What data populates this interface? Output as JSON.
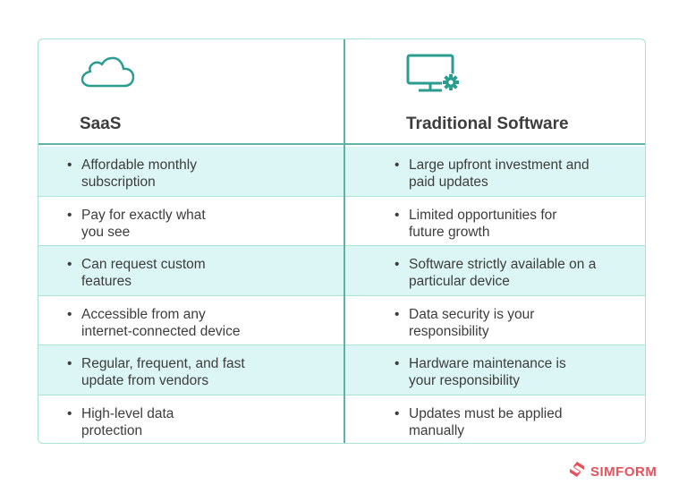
{
  "columns": [
    {
      "title": "SaaS",
      "icon": "cloud-icon"
    },
    {
      "title": "Traditional Software",
      "icon": "monitor-gear-icon"
    }
  ],
  "rows": [
    {
      "saas": "Affordable monthly\nsubscription",
      "traditional": "Large upfront investment and\npaid updates"
    },
    {
      "saas": "Pay for exactly what\nyou see",
      "traditional": "Limited opportunities for\nfuture growth"
    },
    {
      "saas": "Can request custom\nfeatures",
      "traditional": "Software strictly available on a\nparticular device"
    },
    {
      "saas": "Accessible from any\ninternet-connected device",
      "traditional": "Data security is your\nresponsibility"
    },
    {
      "saas": "Regular, frequent, and fast\nupdate from vendors",
      "traditional": "Hardware maintenance is\nyour responsibility"
    },
    {
      "saas": "High-level data\nprotection",
      "traditional": "Updates must be applied\nmanually"
    }
  ],
  "bullet": "•",
  "brand": {
    "name": "SIMFORM",
    "color": "#e8505b"
  },
  "colors": {
    "accent": "#2a9d8f",
    "row_shade": "#dbf6f4",
    "border": "#a8e3d4"
  }
}
